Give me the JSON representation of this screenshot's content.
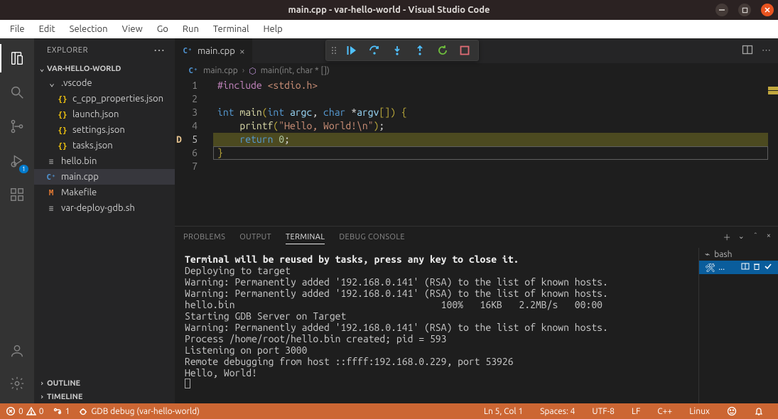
{
  "window": {
    "title": "main.cpp - var-hello-world - Visual Studio Code"
  },
  "menubar": [
    "File",
    "Edit",
    "Selection",
    "View",
    "Go",
    "Run",
    "Terminal",
    "Help"
  ],
  "activity": {
    "run_badge": "1"
  },
  "sidebar": {
    "title": "EXPLORER",
    "root": "VAR-HELLO-WORLD",
    "folder_vscode": ".vscode",
    "files_vscode": [
      "c_cpp_properties.json",
      "launch.json",
      "settings.json",
      "tasks.json"
    ],
    "files_root": [
      {
        "name": "hello.bin",
        "kind": "bin"
      },
      {
        "name": "main.cpp",
        "kind": "cpp"
      },
      {
        "name": "Makefile",
        "kind": "make"
      },
      {
        "name": "var-deploy-gdb.sh",
        "kind": "sh"
      }
    ],
    "outline": "OUTLINE",
    "timeline": "TIMELINE"
  },
  "tabs": {
    "open": [
      {
        "label": "main.cpp"
      }
    ]
  },
  "breadcrumb": {
    "file": "main.cpp",
    "symbol": "main(int, char * [])"
  },
  "editor": {
    "lines": [
      {
        "n": 1,
        "segments": [
          [
            "inc",
            "#include"
          ],
          [
            "pl",
            " "
          ],
          [
            "str",
            "<stdio.h>"
          ]
        ]
      },
      {
        "n": 2,
        "segments": []
      },
      {
        "n": 3,
        "segments": [
          [
            "ty",
            "int"
          ],
          [
            "pl",
            " "
          ],
          [
            "id",
            "main"
          ],
          [
            "br",
            "("
          ],
          [
            "ty",
            "int"
          ],
          [
            "pl",
            " "
          ],
          [
            "var",
            "argc"
          ],
          [
            "op",
            ", "
          ],
          [
            "ty",
            "char"
          ],
          [
            "pl",
            " "
          ],
          [
            "op",
            "*"
          ],
          [
            "var",
            "argv"
          ],
          [
            "br",
            "[]) {"
          ]
        ]
      },
      {
        "n": 4,
        "segments": [
          [
            "pl",
            "    "
          ],
          [
            "id",
            "printf"
          ],
          [
            "br",
            "("
          ],
          [
            "str",
            "\"Hello, World!\\n\""
          ],
          [
            "br",
            ")"
          ],
          [
            "op",
            ";"
          ]
        ]
      },
      {
        "n": 5,
        "segments": [
          [
            "pl",
            "    "
          ],
          [
            "kw",
            "return"
          ],
          [
            "pl",
            " "
          ],
          [
            "num",
            "0"
          ],
          [
            "op",
            ";"
          ]
        ],
        "current": true
      },
      {
        "n": 6,
        "segments": [
          [
            "br",
            "}"
          ]
        ],
        "boxed": true
      },
      {
        "n": 7,
        "segments": []
      }
    ],
    "breakpoint_glyph_line": 5
  },
  "panel": {
    "tabs": [
      "PROBLEMS",
      "OUTPUT",
      "TERMINAL",
      "DEBUG CONSOLE"
    ],
    "active": 2,
    "terminal_entries": [
      {
        "label": "bash",
        "active": false
      },
      {
        "label": "...",
        "active": true
      }
    ],
    "terminal_lines": [
      "Terminal will be reused by tasks, press any key to close it.",
      "",
      "Deploying to target",
      "Warning: Permanently added '192.168.0.141' (RSA) to the list of known hosts.",
      "Warning: Permanently added '192.168.0.141' (RSA) to the list of known hosts.",
      "hello.bin                                     100%   16KB   2.2MB/s   00:00",
      "Starting GDB Server on Target",
      "Warning: Permanently added '192.168.0.141' (RSA) to the list of known hosts.",
      "Process /home/root/hello.bin created; pid = 593",
      "Listening on port 3000",
      "Remote debugging from host ::ffff:192.168.0.229, port 53926",
      "Hello, World!"
    ]
  },
  "statusbar": {
    "errors": "0",
    "warnings": "0",
    "ports": "1",
    "debug": "GDB debug (var-hello-world)",
    "pos": "Ln 5, Col 1",
    "spaces": "Spaces: 4",
    "encoding": "UTF-8",
    "eol": "LF",
    "lang": "C++",
    "os": "Linux"
  }
}
